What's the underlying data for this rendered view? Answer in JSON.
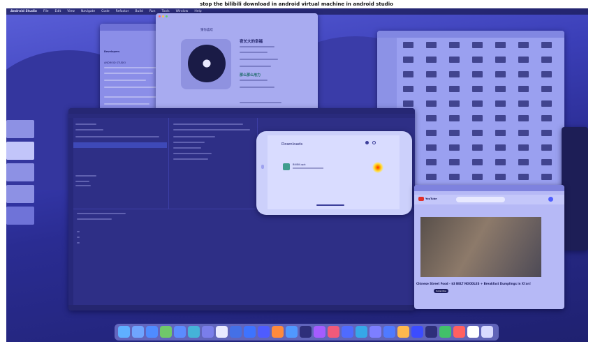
{
  "caption": "stop the bilibili download in android virtual machine in android studio",
  "menubar": {
    "items": [
      "Android Studio",
      "File",
      "Edit",
      "View",
      "Navigate",
      "Code",
      "Refactor",
      "Build",
      "Run",
      "Tools",
      "Window",
      "Help"
    ]
  },
  "music_app": {
    "header": "猜你喜欢",
    "song": "夜长大的幸福",
    "highlight": "那么那么用力"
  },
  "browser_top": {
    "brand": "Developers",
    "section": "ANDROID STUDIO"
  },
  "emulator": {
    "screen_title": "Downloads",
    "file_name": "BiliBili.apk"
  },
  "youtube": {
    "logo": "YouTube",
    "video_title": "Chinese Street Food - $3 BELT NOODLES + Breakfast Dumplings in Xi'an!",
    "subscribe": "Subscribe"
  },
  "dock": {
    "icon_colors": [
      "#5fb0ff",
      "#6fa5ff",
      "#4f8cff",
      "#70c86a",
      "#5b8cff",
      "#45b3d8",
      "#7a7eea",
      "#e9e9ff",
      "#4470e6",
      "#3d73ff",
      "#4e5cff",
      "#ff8a3d",
      "#5098ff",
      "#2e2f7a",
      "#a45cff",
      "#f05a7a",
      "#4f6bff",
      "#36a7e8",
      "#7d7fff",
      "#4f7aff",
      "#ffb84d",
      "#3b4cff",
      "#2e2f7a",
      "#42c06a",
      "#ff6060",
      "#ffffff",
      "#d8daff"
    ]
  },
  "colors": {
    "desktop": "#3b3fb8",
    "emulator_heat": "#ff2a00"
  }
}
